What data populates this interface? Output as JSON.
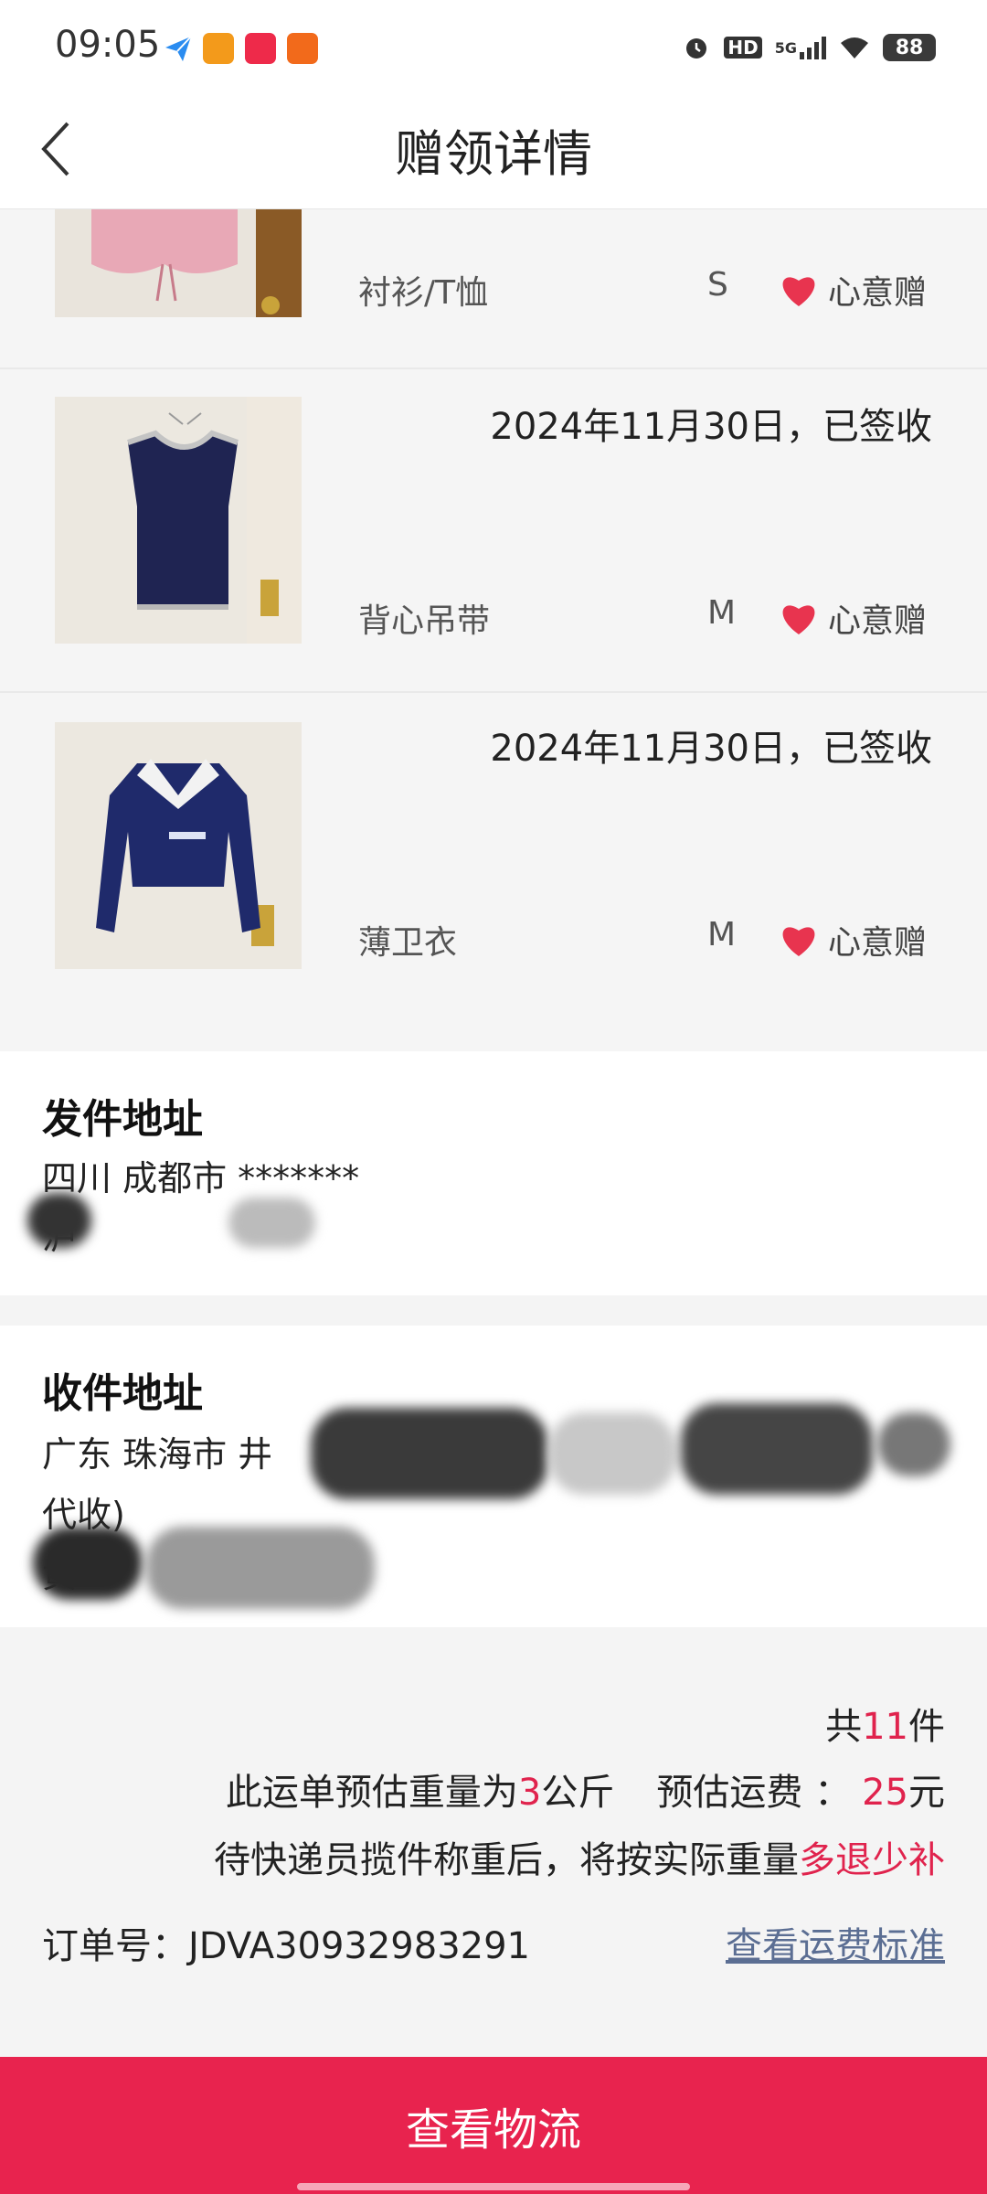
{
  "status_bar": {
    "time": "09:05",
    "battery": "88",
    "network": "5G",
    "hd": "HD"
  },
  "header": {
    "title": "赠领详情",
    "back_icon": "chevron-left-icon"
  },
  "items": [
    {
      "date": "",
      "name": "衬衫/T恤",
      "size": "S",
      "gift_label": "心意赠"
    },
    {
      "date": "2024年11月30日，已签收",
      "name": "背心吊带",
      "size": "M",
      "gift_label": "心意赠"
    },
    {
      "date": "2024年11月30日，已签收",
      "name": "薄卫衣",
      "size": "M",
      "gift_label": "心意赠"
    }
  ],
  "sender": {
    "title": "发件地址",
    "line1": "四川 成都市 *******",
    "line2": "泸"
  },
  "receiver": {
    "title": "收件地址",
    "line1": "广东 珠海市 井",
    "line2": "代收)",
    "line3": "黄"
  },
  "summary": {
    "total_prefix": "共",
    "total_count": "11",
    "total_suffix": "件",
    "weight_prefix": "此运单预估重量为",
    "weight_value": "3",
    "weight_suffix": "公斤",
    "fee_prefix": "预估运费 ：",
    "fee_value": "25",
    "fee_suffix": "元",
    "note_prefix": "待快递员揽件称重后，将按实际重量",
    "note_highlight": "多退少补",
    "order_label": "订单号：",
    "order_number": "JDVA30932983291",
    "fee_link": "查看运费标准"
  },
  "bottom_button": {
    "label": "查看物流"
  },
  "colors": {
    "accent": "#e8234e",
    "heart": "#e8344f",
    "link": "#5b6e93"
  }
}
